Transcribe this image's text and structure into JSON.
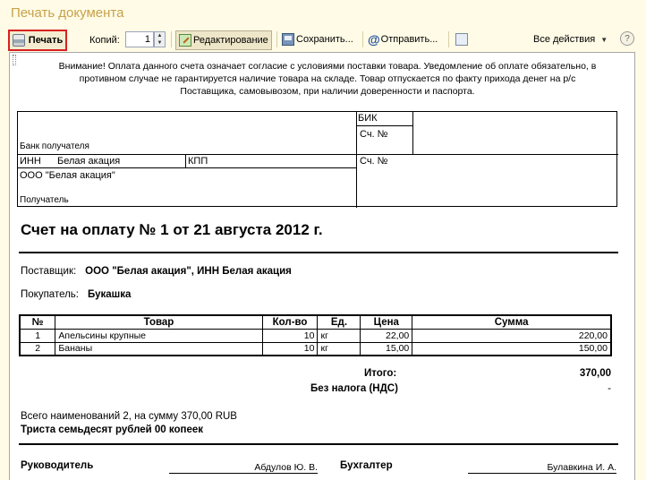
{
  "window": {
    "title": "Печать документа"
  },
  "toolbar": {
    "print_label": "Печать",
    "copies_label": "Копий:",
    "copies_value": "1",
    "edit_label": "Редактирование",
    "save_label": "Сохранить...",
    "send_label": "Отправить...",
    "all_actions_label": "Все действия",
    "help_label": "?"
  },
  "document": {
    "notice": "Внимание! Оплата данного счета означает согласие с условиями поставки товара. Уведомление об оплате обязательно, в противном случае не гарантируется наличие товара на складе. Товар отпускается по факту прихода денег на р/с Поставщика, самовывозом, при наличии доверенности и паспорта.",
    "bank": {
      "bik_label": "БИК",
      "account_label": "Сч. №",
      "recipient_bank_label": "Банк получателя",
      "inn_label": "ИНН",
      "inn_value": "Белая акация",
      "kpp_label": "КПП",
      "account_label2": "Сч. №",
      "recipient_name": "ООО \"Белая акация\"",
      "recipient_label": "Получатель"
    },
    "invoice_title": "Счет на оплату № 1 от 21 августа 2012 г.",
    "supplier_label": "Поставщик:",
    "supplier_value": "ООО \"Белая акация\", ИНН Белая акация",
    "buyer_label": "Покупатель:",
    "buyer_value": "Букашка",
    "table": {
      "headers": {
        "num": "№",
        "item": "Товар",
        "qty": "Кол-во",
        "unit": "Ед.",
        "price": "Цена",
        "sum": "Сумма"
      },
      "rows": [
        {
          "num": "1",
          "item": "Апельсины крупные",
          "qty": "10",
          "unit": "кг",
          "price": "22,00",
          "sum": "220,00"
        },
        {
          "num": "2",
          "item": "Бананы",
          "qty": "10",
          "unit": "кг",
          "price": "15,00",
          "sum": "150,00"
        }
      ]
    },
    "total_label": "Итого:",
    "total_value": "370,00",
    "vat_label": "Без налога (НДС)",
    "vat_value": "-",
    "summary_count": "Всего наименований 2, на сумму 370,00 RUB",
    "summary_words": "Триста семьдесят рублей 00 копеек",
    "signatures": {
      "director_label": "Руководитель",
      "director_name": "Абдулов Ю. В.",
      "accountant_label": "Бухгалтер",
      "accountant_name": "Булавкина И. А."
    }
  }
}
